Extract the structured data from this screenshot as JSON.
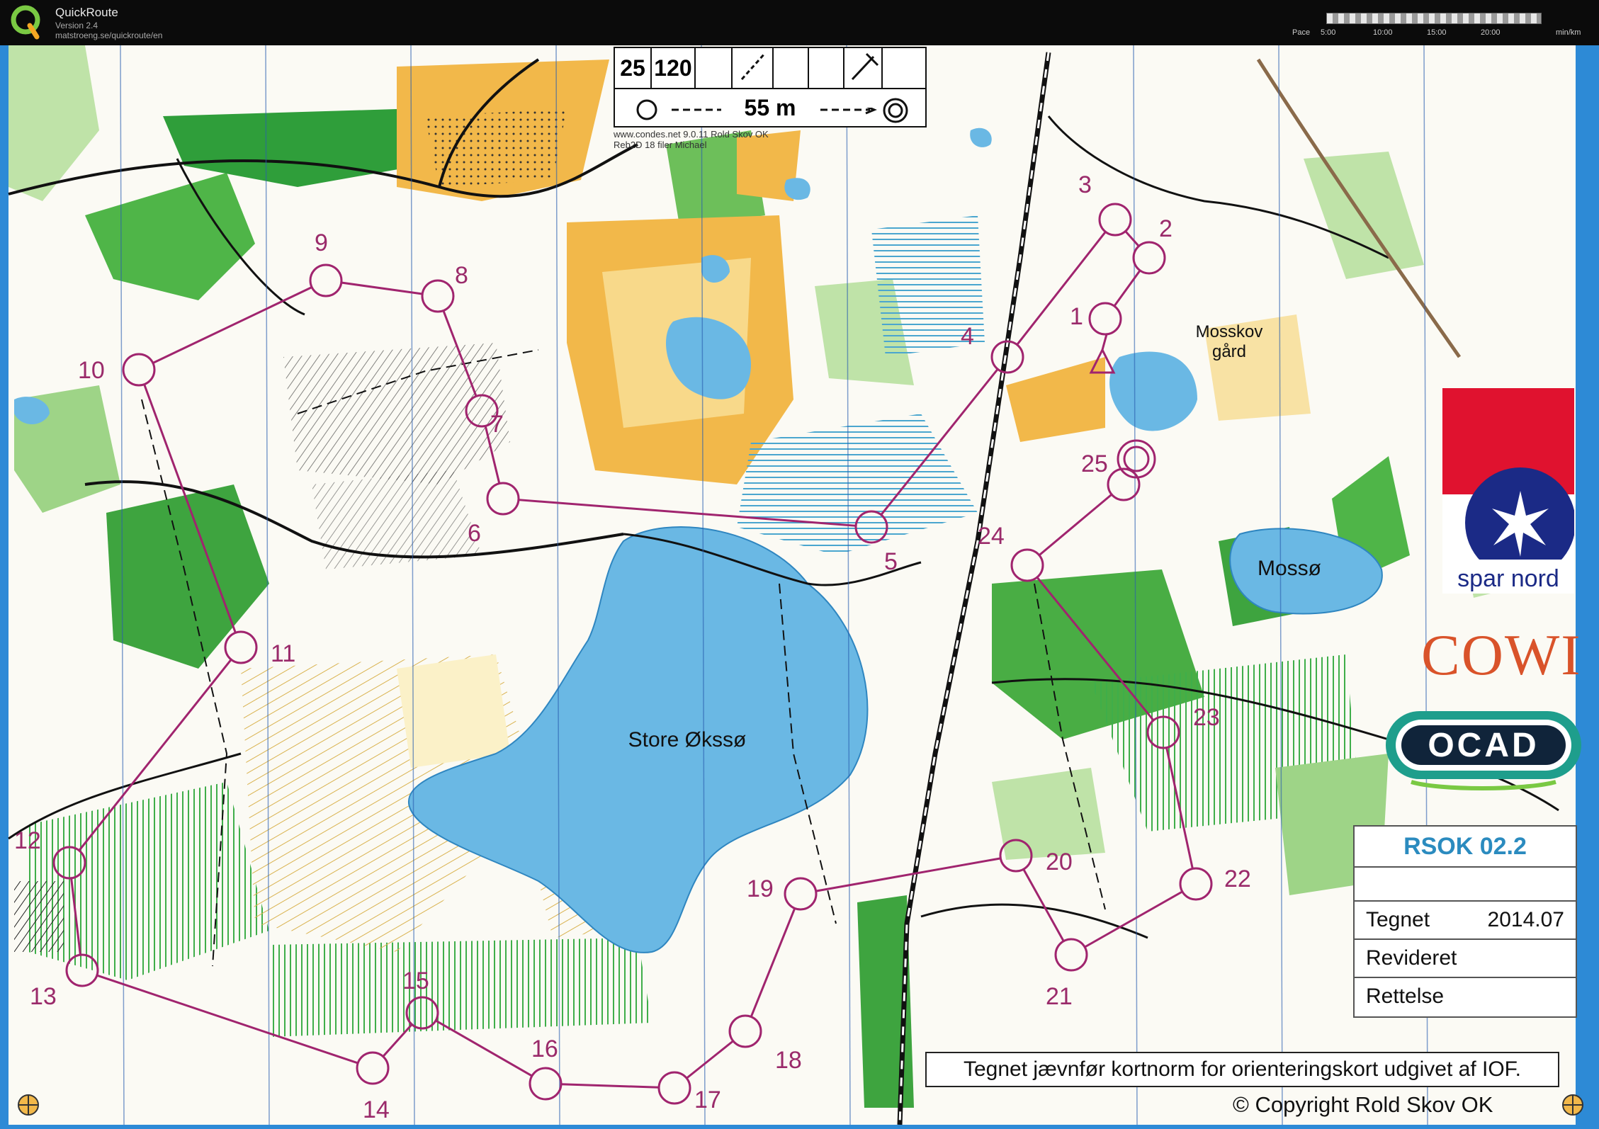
{
  "app": {
    "name": "QuickRoute",
    "version": "Version 2.4",
    "url": "matstroeng.se/quickroute/en",
    "pace_labels": [
      "Pace",
      "5:00",
      "10:00",
      "15:00",
      "20:00",
      "min/km"
    ]
  },
  "description_card": {
    "course": "25",
    "climb": "120",
    "distance": "55 m"
  },
  "print_note": [
    "www.condes.net 9.0.11 Rold Skov OK",
    "Reb2D 18 filer Michael"
  ],
  "map": {
    "lake_labels": [
      "Store Økssø",
      "Mossø"
    ],
    "place_label": [
      "Mosskov",
      "gård"
    ],
    "controls": [
      {
        "n": "1"
      },
      {
        "n": "2"
      },
      {
        "n": "3"
      },
      {
        "n": "4"
      },
      {
        "n": "5"
      },
      {
        "n": "6"
      },
      {
        "n": "7"
      },
      {
        "n": "8"
      },
      {
        "n": "9"
      },
      {
        "n": "10"
      },
      {
        "n": "11"
      },
      {
        "n": "12"
      },
      {
        "n": "13"
      },
      {
        "n": "14"
      },
      {
        "n": "15"
      },
      {
        "n": "16"
      },
      {
        "n": "17"
      },
      {
        "n": "18"
      },
      {
        "n": "19"
      },
      {
        "n": "20"
      },
      {
        "n": "21"
      },
      {
        "n": "22"
      },
      {
        "n": "23"
      },
      {
        "n": "24"
      },
      {
        "n": "25"
      }
    ],
    "course_color": "#a0246e",
    "water_color": "#6ab8e4",
    "forest_green": "#3faa3a",
    "open_yellow": "#f2b84a"
  },
  "sponsors": {
    "spar_nord": "spar nord",
    "cowi": "COWI",
    "ocad": "OCAD"
  },
  "event": {
    "title": "RSOK 02.2",
    "rows": [
      {
        "label": "Tegnet",
        "value": "2014.07"
      },
      {
        "label": "Revideret",
        "value": ""
      },
      {
        "label": "Rettelse",
        "value": ""
      }
    ]
  },
  "legal_note": "Tegnet jævnfør kortnorm for orienteringskort udgivet af IOF.",
  "copyright": "©  Copyright Rold Skov OK"
}
